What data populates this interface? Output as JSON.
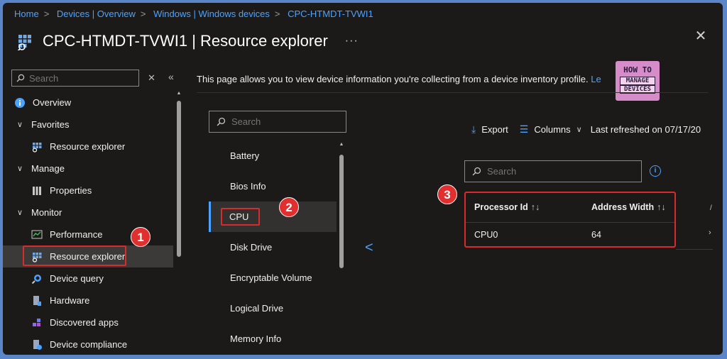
{
  "breadcrumb": [
    "Home",
    "Devices | Overview",
    "Windows | Windows devices",
    "CPC-HTMDT-TVWI1"
  ],
  "header": {
    "title": "CPC-HTMDT-TVWI1 | Resource explorer",
    "more": "···",
    "close": "✕"
  },
  "sidebar": {
    "search_placeholder": "Search",
    "items": [
      {
        "label": "Overview",
        "icon": "info-icon",
        "level": 0
      },
      {
        "label": "Favorites",
        "icon": "chevron-down-icon",
        "level": 0
      },
      {
        "label": "Resource explorer",
        "icon": "grid-icon",
        "level": 1
      },
      {
        "label": "Manage",
        "icon": "chevron-down-icon",
        "level": 0
      },
      {
        "label": "Properties",
        "icon": "bars-icon",
        "level": 1
      },
      {
        "label": "Monitor",
        "icon": "chevron-down-icon",
        "level": 0
      },
      {
        "label": "Performance",
        "icon": "chart-icon",
        "level": 1
      },
      {
        "label": "Resource explorer",
        "icon": "grid-icon",
        "level": 1,
        "active": true
      },
      {
        "label": "Device query",
        "icon": "query-icon",
        "level": 1
      },
      {
        "label": "Hardware",
        "icon": "hardware-icon",
        "level": 1
      },
      {
        "label": "Discovered apps",
        "icon": "apps-icon",
        "level": 1
      },
      {
        "label": "Device compliance",
        "icon": "compliance-icon",
        "level": 1
      }
    ]
  },
  "main": {
    "description": "This page allows you to view device information you're collecting from a device inventory profile.",
    "description_link": "Le",
    "logo": {
      "line1": "HOW TO",
      "line2": "MANAGE",
      "line3": "DEVICES"
    },
    "categories": {
      "search_placeholder": "Search",
      "items": [
        "Battery",
        "Bios Info",
        "CPU",
        "Disk Drive",
        "Encryptable Volume",
        "Logical Drive",
        "Memory Info"
      ],
      "selected": "CPU"
    },
    "toolbar": {
      "export": "Export",
      "columns": "Columns",
      "last_refreshed": "Last refreshed on 07/17/20"
    },
    "table": {
      "search_placeholder": "Search",
      "columns": [
        "Processor Id",
        "Address Width"
      ],
      "rows": [
        [
          "CPU0",
          "64"
        ]
      ]
    }
  },
  "annotations": [
    "1",
    "2",
    "3"
  ],
  "colors": {
    "accent": "#4aa3ff",
    "highlight": "#d92b2b",
    "background": "#1b1a19"
  }
}
